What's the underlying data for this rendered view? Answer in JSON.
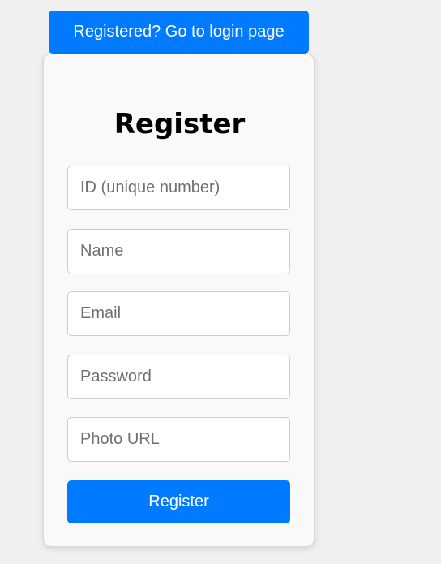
{
  "header": {
    "login_link_label": "Registered? Go to login page"
  },
  "form": {
    "title": "Register",
    "fields": {
      "id": {
        "placeholder": "ID (unique number)",
        "value": ""
      },
      "name": {
        "placeholder": "Name",
        "value": ""
      },
      "email": {
        "placeholder": "Email",
        "value": ""
      },
      "password": {
        "placeholder": "Password",
        "value": ""
      },
      "photo_url": {
        "placeholder": "Photo URL",
        "value": ""
      }
    },
    "submit_label": "Register"
  },
  "colors": {
    "accent": "#007bff",
    "page_background": "#f0f0f0",
    "card_background": "#f9f9f9",
    "button_text": "#ffffff"
  }
}
